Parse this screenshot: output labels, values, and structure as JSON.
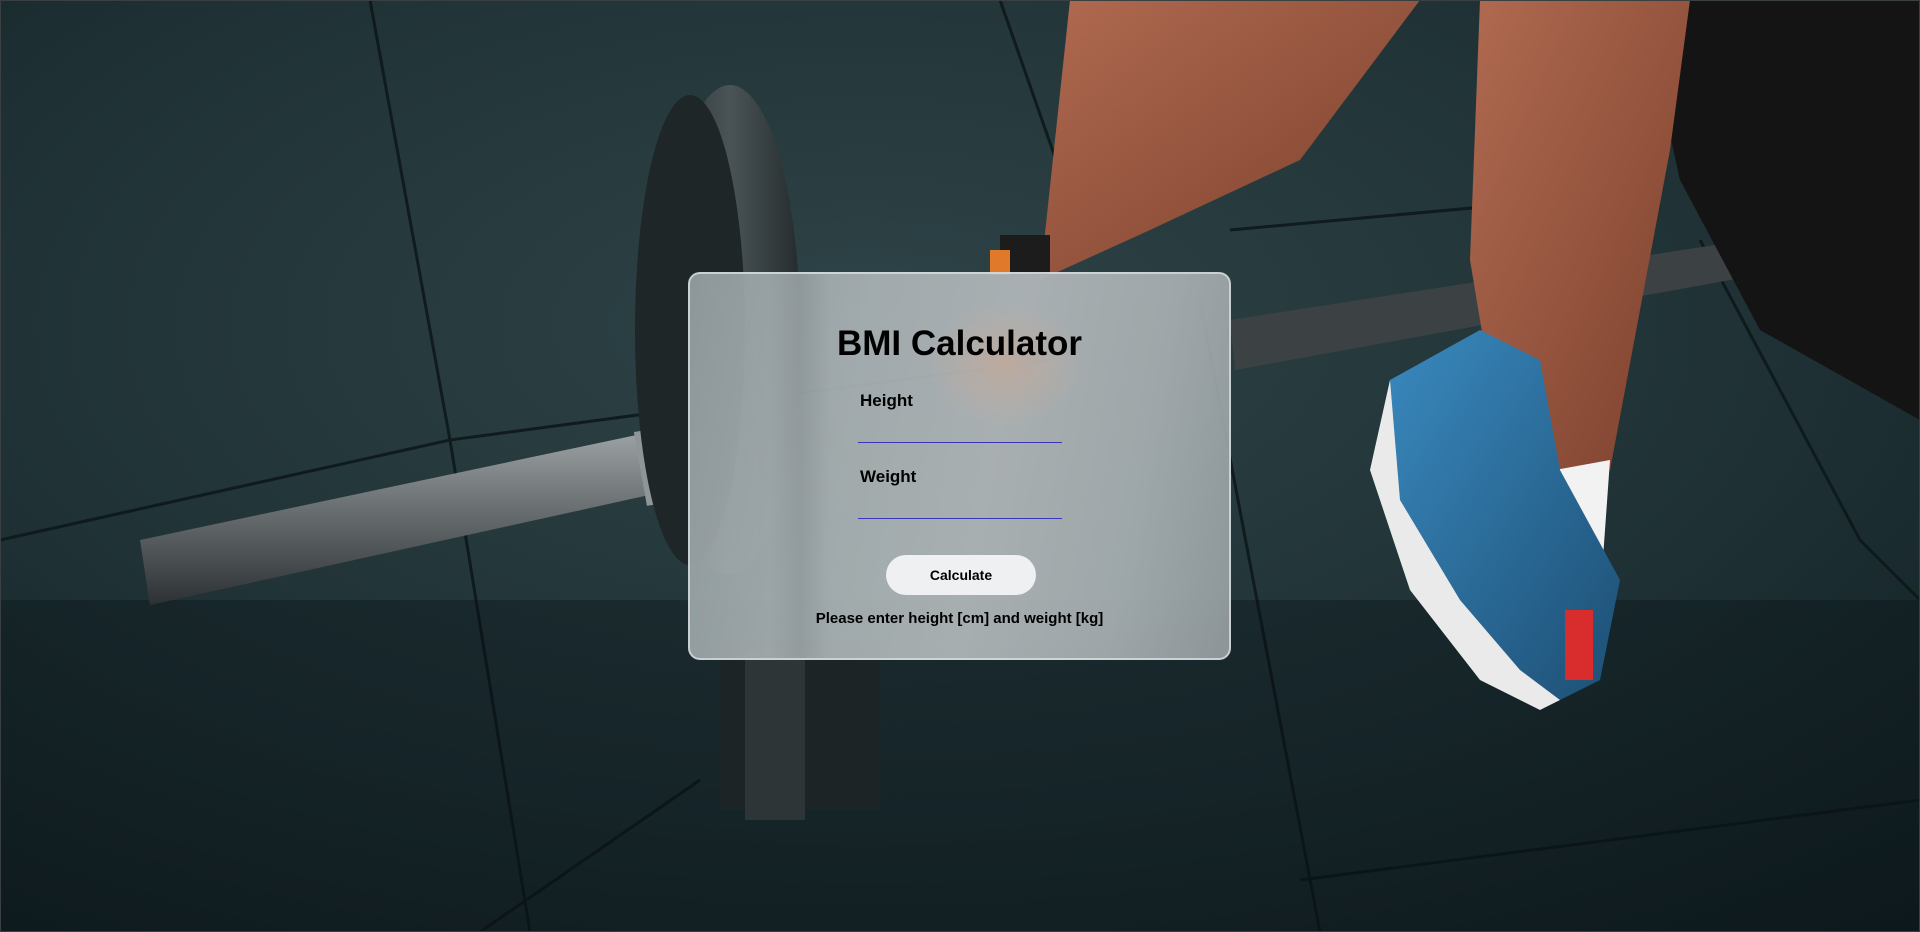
{
  "card": {
    "title": "BMI Calculator",
    "height_label": "Height",
    "height_value": "",
    "weight_label": "Weight",
    "weight_value": "",
    "calculate_label": "Calculate",
    "result_text": "Please enter height [cm] and weight [kg]"
  },
  "colors": {
    "input_underline": "#3a36b8",
    "button_bg": "#eef0f1",
    "card_border": "#dce2e4"
  }
}
